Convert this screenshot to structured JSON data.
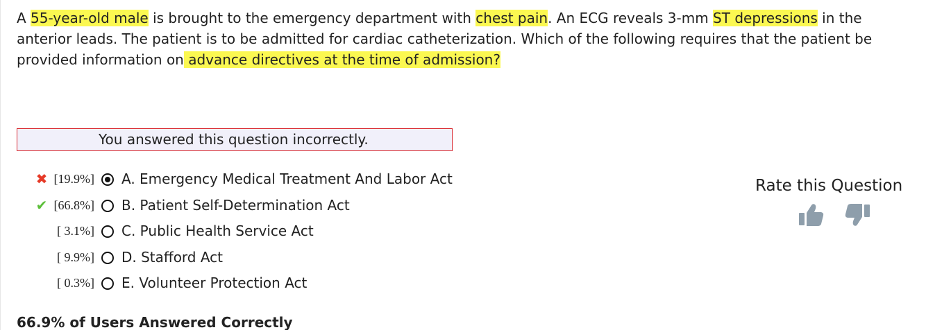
{
  "question": {
    "segments": [
      {
        "text": "A ",
        "highlight": false
      },
      {
        "text": "55-year-old male",
        "highlight": true
      },
      {
        "text": " is brought to the emergency department with ",
        "highlight": false
      },
      {
        "text": "chest pain",
        "highlight": true
      },
      {
        "text": ". An ECG reveals 3-mm ",
        "highlight": false
      },
      {
        "text": "ST depressions",
        "highlight": true
      },
      {
        "text": " in the anterior leads. The patient is to be admitted for cardiac catheterization. Which of the following requires that the patient be provided information on",
        "highlight": false
      },
      {
        "text": " advance directives at the time of admission?",
        "highlight": true
      }
    ]
  },
  "result": {
    "message": "You answered this question incorrectly."
  },
  "answers": [
    {
      "mark": "✖",
      "mark_type": "wrong",
      "percent": "[19.9%]",
      "selected": true,
      "text": "A. Emergency Medical Treatment And Labor Act"
    },
    {
      "mark": "✔",
      "mark_type": "right",
      "percent": "[66.8%]",
      "selected": false,
      "text": "B. Patient Self-Determination Act"
    },
    {
      "mark": "",
      "mark_type": "none",
      "percent": "[ 3.1%]",
      "selected": false,
      "text": "C. Public Health Service Act"
    },
    {
      "mark": "",
      "mark_type": "none",
      "percent": "[ 9.9%]",
      "selected": false,
      "text": "D. Stafford Act"
    },
    {
      "mark": "",
      "mark_type": "none",
      "percent": "[ 0.3%]",
      "selected": false,
      "text": "E. Volunteer Protection Act"
    }
  ],
  "rating": {
    "title": "Rate this Question",
    "thumbs_up_icon": "thumbs-up-icon",
    "thumbs_down_icon": "thumbs-down-icon",
    "icon_color": "#8e9eab"
  },
  "summary": {
    "text": "66.9% of Users Answered Correctly"
  },
  "colors": {
    "highlight": "#fbf851",
    "wrong_mark": "#e63a27",
    "right_mark": "#5cbf3a",
    "result_border": "#d9282f",
    "result_background": "#f1f0fa"
  }
}
